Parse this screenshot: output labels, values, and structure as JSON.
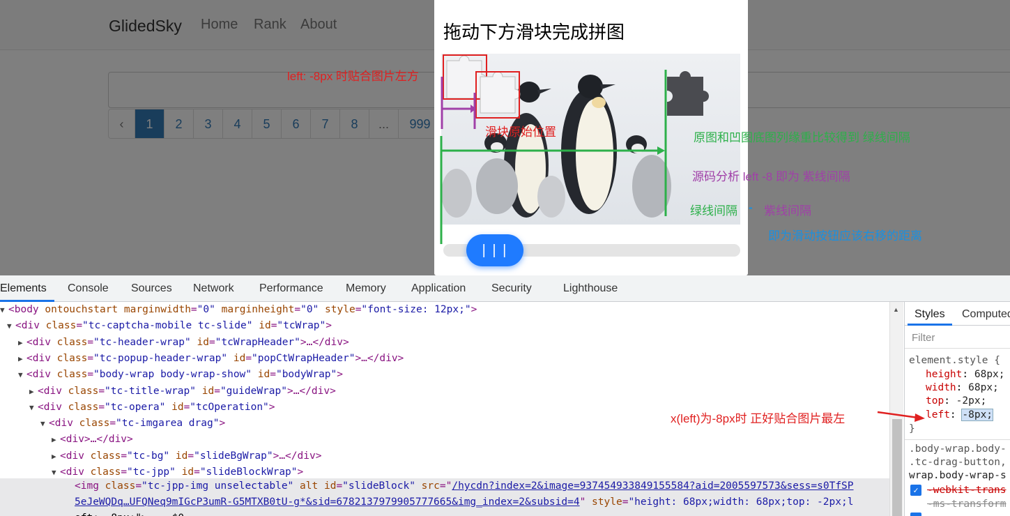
{
  "navbar": {
    "brand": "GlidedSky",
    "links": [
      "Home",
      "Rank",
      "About"
    ]
  },
  "pagination": {
    "prev": "‹",
    "pages": [
      "1",
      "2",
      "3",
      "4",
      "5",
      "6",
      "7",
      "8",
      "...",
      "999"
    ],
    "active": "1"
  },
  "captcha": {
    "title": "拖动下方滑块完成拼图",
    "slider_label": "| | |"
  },
  "annotations": {
    "left_align": "left: -8px 时贴合图片左方",
    "original_pos": "滑块原始位置",
    "green_desc": "原图和凹图底图列缘重比较得到 绿线间隔",
    "purple_desc": "源码分析 left -8 即为 紫线间隔",
    "green_label": "绿线间隔",
    "dash": "-",
    "purple_label": "紫线间隔",
    "result": "即为滑动按钮应该右移的距离",
    "xleft": "x(left)为-8px时 正好贴合图片最左"
  },
  "devtools": {
    "tabs": [
      "Elements",
      "Console",
      "Sources",
      "Network",
      "Performance",
      "Memory",
      "Application",
      "Security",
      "Lighthouse"
    ],
    "active_tab": "Elements",
    "code": [
      {
        "tri": "▼",
        "pre": "<body ",
        "attrs": [
          [
            "ontouchstart",
            ""
          ],
          [
            "marginwidth",
            "\"0\""
          ],
          [
            "marginheight",
            "\"0\""
          ],
          [
            "style",
            "\"font-size: 12px;\""
          ]
        ],
        "post": ">"
      },
      {
        "tri": "▼",
        "pre": "<div ",
        "attrs": [
          [
            "class",
            "\"tc-captcha-mobile tc-slide\""
          ],
          [
            "id",
            "\"tcWrap\""
          ]
        ],
        "post": ">"
      },
      {
        "tri": "▶",
        "pre": "<div ",
        "attrs": [
          [
            "class",
            "\"tc-header-wrap\""
          ],
          [
            "id",
            "\"tcWrapHeader\""
          ]
        ],
        "post": ">…</div>"
      },
      {
        "tri": "▶",
        "pre": "<div ",
        "attrs": [
          [
            "class",
            "\"tc-popup-header-wrap\""
          ],
          [
            "id",
            "\"popCtWrapHeader\""
          ]
        ],
        "post": ">…</div>"
      },
      {
        "tri": "▼",
        "pre": "<div ",
        "attrs": [
          [
            "class",
            "\"body-wrap body-wrap-show\""
          ],
          [
            "id",
            "\"bodyWrap\""
          ]
        ],
        "post": ">"
      },
      {
        "tri": "▶",
        "pre": "<div ",
        "attrs": [
          [
            "class",
            "\"tc-title-wrap\""
          ],
          [
            "id",
            "\"guideWrap\""
          ]
        ],
        "post": ">…</div>"
      },
      {
        "tri": "▼",
        "pre": "<div ",
        "attrs": [
          [
            "class",
            "\"tc-opera\""
          ],
          [
            "id",
            "\"tcOperation\""
          ]
        ],
        "post": ">"
      },
      {
        "tri": "▼",
        "pre": "<div ",
        "attrs": [
          [
            "class",
            "\"tc-imgarea drag\""
          ]
        ],
        "post": ">"
      },
      {
        "tri": "▶",
        "pre": "<div>",
        "attrs": [],
        "post": "…</div>"
      },
      {
        "tri": "▶",
        "pre": "<div ",
        "attrs": [
          [
            "class",
            "\"tc-bg\""
          ],
          [
            "id",
            "\"slideBgWrap\""
          ]
        ],
        "post": ">…</div>"
      },
      {
        "tri": "▼",
        "pre": "<div ",
        "attrs": [
          [
            "class",
            "\"tc-jpp\""
          ],
          [
            "id",
            "\"slideBlockWrap\""
          ]
        ],
        "post": ">"
      }
    ],
    "img_line1_pre": "<img ",
    "img_attr_class": "class",
    "img_val_class": "\"tc-jpp-img unselectable\"",
    "img_attr_alt": "alt",
    "img_attr_id": "id",
    "img_val_id": "\"slideBlock\"",
    "img_attr_src": "src",
    "img_src_link1": "/hycdn?index=2&image=937454933849155584?aid=2005597573&sess=s0TfSP",
    "img_src_link2": "5eJeWQDq…UFQNeq9mIGcP3umR-G5MTXB0tU-g*&sid=6782137979905777665&img_index=2&subsid=4",
    "img_attr_style": "style",
    "img_val_style": "\"height: 68px;width: 68px;top: -2px;l",
    "img_line3": "eft: -8px;\"> == $0",
    "styles": {
      "tabs": [
        "Styles",
        "Computed"
      ],
      "filter": "Filter",
      "selector": "element.style {",
      "props": [
        [
          "height",
          "68px;"
        ],
        [
          "width",
          "68px;"
        ],
        [
          "top",
          "-2px;"
        ],
        [
          "left",
          "-8px;"
        ]
      ],
      "close": "}",
      "rule_lines": [
        ".body-wrap.body-",
        ".tc-drag-button,",
        "wrap.body-wrap-s"
      ],
      "strike_props": [
        "-webkit-trans",
        "-ms-transform"
      ]
    }
  }
}
